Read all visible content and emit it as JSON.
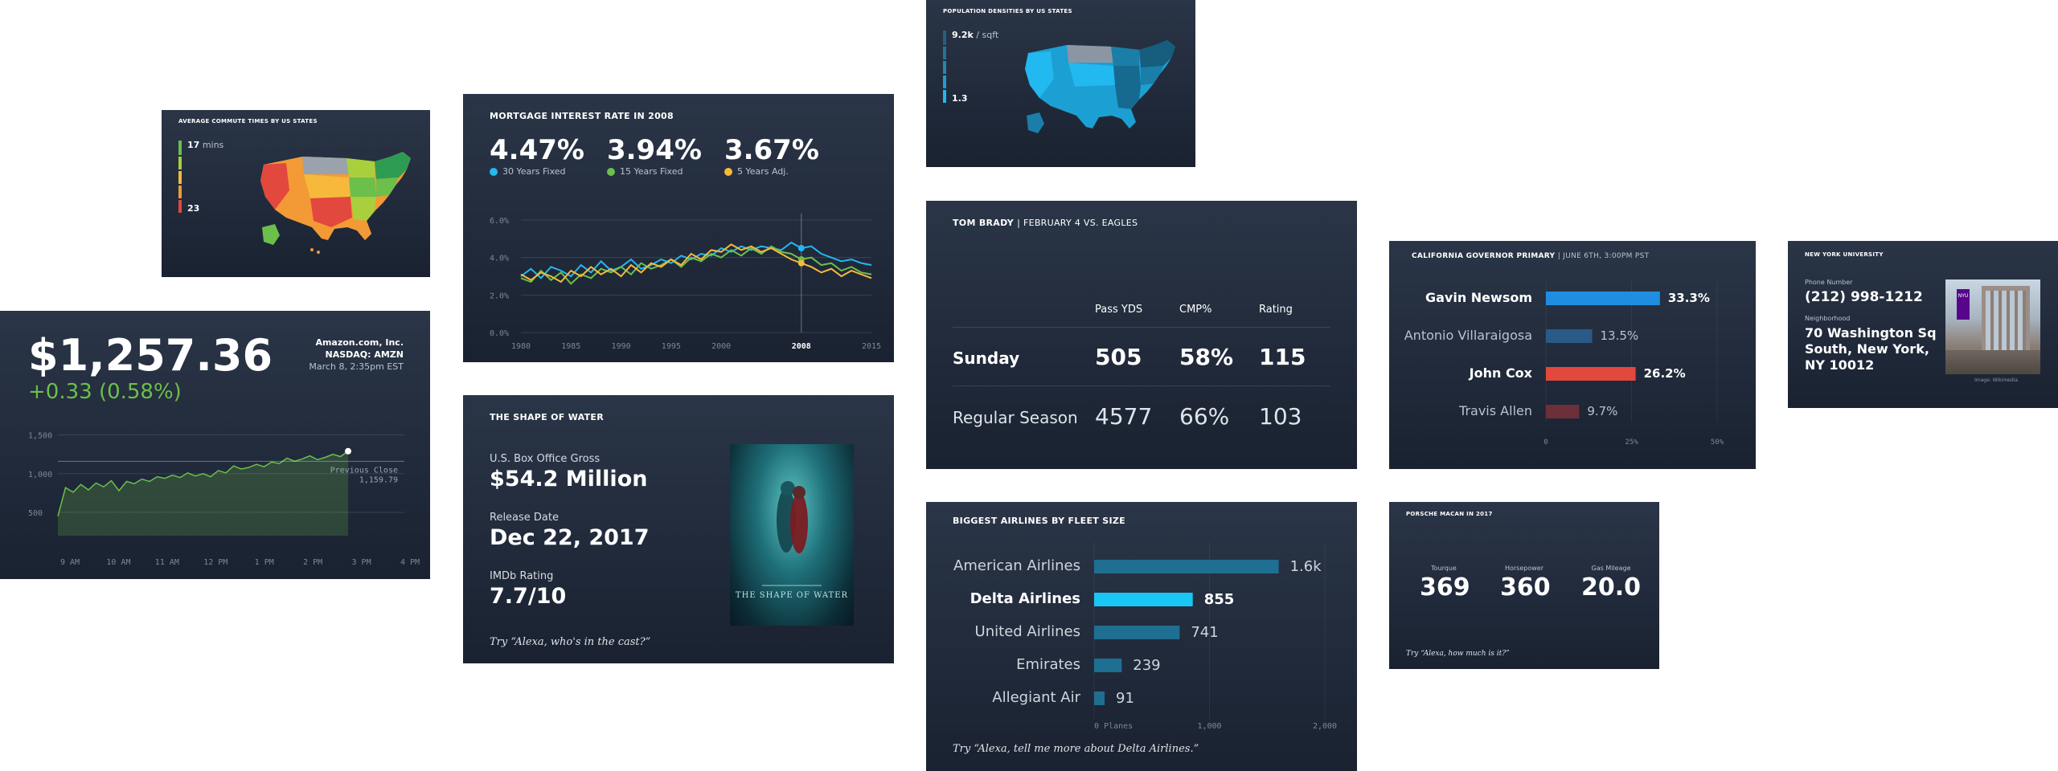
{
  "colors": {
    "blue": "#22b8f0",
    "green": "#6cbf4b",
    "yellow": "#f6b93b",
    "red": "#e2483d",
    "bar_blue": "#1f8de0",
    "bar_dark_blue": "#2a5a86",
    "bar_teal": "#1e6f91",
    "bar_cyan": "#19c6f4",
    "bar_dark_red": "#6d2f3a"
  },
  "commute": {
    "title": "AVERAGE COMMUTE TIMES BY US STATES",
    "max_value": "17",
    "max_unit": "mins",
    "min_value": "23",
    "legend_colors": [
      "#6cbf4b",
      "#a9cf3d",
      "#f6b93b",
      "#f39a36",
      "#e2483d"
    ],
    "map_icon": "us-map-icon"
  },
  "mortgage": {
    "title": "MORTGAGE INTEREST RATE IN 2008",
    "rates": [
      {
        "value": "4.47%",
        "label": "30 Years Fixed",
        "color": "#22b8f0"
      },
      {
        "value": "3.94%",
        "label": "15 Years Fixed",
        "color": "#6cbf4b"
      },
      {
        "value": "3.67%",
        "label": "5 Years Adj.",
        "color": "#f6b93b"
      }
    ],
    "y_ticks": [
      "6.0%",
      "4.0%",
      "2.0%",
      "0.0%"
    ],
    "x_ticks": [
      "1980",
      "1985",
      "1990",
      "1995",
      "2000",
      "2008",
      "2015"
    ]
  },
  "mortgage_chart": {
    "type": "line",
    "x": [
      1980,
      1981,
      1982,
      1983,
      1984,
      1985,
      1986,
      1987,
      1988,
      1989,
      1990,
      1991,
      1992,
      1993,
      1994,
      1995,
      1996,
      1997,
      1998,
      1999,
      2000,
      2001,
      2002,
      2003,
      2004,
      2005,
      2006,
      2007,
      2008,
      2009,
      2010,
      2011,
      2012,
      2013,
      2014,
      2015
    ],
    "series": [
      {
        "name": "30 Years Fixed",
        "color": "#22b8f0",
        "values": [
          3.0,
          3.4,
          2.9,
          3.5,
          3.3,
          3.0,
          3.6,
          3.2,
          3.8,
          3.3,
          3.5,
          3.9,
          3.4,
          3.6,
          3.9,
          3.7,
          4.1,
          3.9,
          4.2,
          4.1,
          4.5,
          4.3,
          4.6,
          4.4,
          4.6,
          4.5,
          4.4,
          4.8,
          4.5,
          4.6,
          4.2,
          4.0,
          3.8,
          3.9,
          3.7,
          3.6
        ]
      },
      {
        "name": "15 Years Fixed",
        "color": "#6cbf4b",
        "values": [
          2.9,
          2.7,
          3.3,
          2.8,
          3.2,
          2.6,
          3.1,
          2.9,
          3.4,
          3.2,
          3.5,
          3.1,
          3.7,
          3.4,
          3.6,
          3.9,
          3.5,
          4.0,
          3.8,
          4.2,
          4.0,
          4.4,
          4.1,
          4.5,
          4.2,
          4.6,
          4.3,
          4.2,
          3.9,
          4.0,
          3.6,
          3.7,
          3.3,
          3.5,
          3.2,
          3.1
        ]
      },
      {
        "name": "5 Years Adj.",
        "color": "#f6b93b",
        "values": [
          3.1,
          2.8,
          3.2,
          3.0,
          2.7,
          3.3,
          3.0,
          3.5,
          3.1,
          3.4,
          3.0,
          3.6,
          3.2,
          3.7,
          3.5,
          3.9,
          3.6,
          4.2,
          3.9,
          4.4,
          4.3,
          4.7,
          4.4,
          4.6,
          4.3,
          4.5,
          4.2,
          3.9,
          3.7,
          3.5,
          3.2,
          3.4,
          3.0,
          3.3,
          3.1,
          2.9
        ]
      }
    ],
    "ylim": [
      0,
      6
    ],
    "highlight_x": 2008
  },
  "population": {
    "title": "POPULATION DENSITIES BY US STATES",
    "max_value": "9.2k",
    "max_unit": "/ sqft",
    "min_value": "1.3",
    "map_icon": "us-map-icon"
  },
  "stock": {
    "price": "$1,257.36",
    "change": "+0.33 (0.58%)",
    "company": "Amazon.com, Inc.",
    "ticker": "NASDAQ: AMZN",
    "date": "March 8, 2:35pm EST",
    "y_ticks": [
      "1,500",
      "1,000",
      "500"
    ],
    "x_ticks": [
      "9 AM",
      "10 AM",
      "11 AM",
      "12 PM",
      "1 PM",
      "2 PM",
      "3 PM",
      "4 PM"
    ],
    "prev_close_label": "Previous Close",
    "prev_close_value": "1,159.79"
  },
  "stock_chart": {
    "type": "area",
    "values": [
      450,
      820,
      760,
      860,
      790,
      880,
      830,
      910,
      780,
      900,
      870,
      930,
      900,
      960,
      940,
      980,
      950,
      1010,
      970,
      1000,
      960,
      1040,
      1010,
      1100,
      1060,
      1080,
      1120,
      1090,
      1150,
      1130,
      1200,
      1160,
      1190,
      1230,
      1180,
      1210,
      1250,
      1220,
      1290
    ],
    "ylim": [
      200,
      1650
    ],
    "prev_close": 1159.79,
    "color": "#6cbf4b"
  },
  "movie": {
    "title": "THE SHAPE OF WATER",
    "items": [
      {
        "label": "U.S. Box Office Gross",
        "value": "$54.2 Million"
      },
      {
        "label": "Release Date",
        "value": "Dec 22, 2017"
      },
      {
        "label": "IMDb Rating",
        "value": "7.7/10"
      }
    ],
    "hint": "Try “Alexa, who's in the cast?”",
    "poster_title": "THE SHAPE OF WATER"
  },
  "brady": {
    "title_bold": "TOM BRADY",
    "title_rest": "| FEBRUARY 4 VS. EAGLES",
    "headers": [
      "Pass YDS",
      "CMP%",
      "Rating"
    ],
    "rows": [
      {
        "label": "Sunday",
        "values": [
          "505",
          "58%",
          "115"
        ]
      },
      {
        "label": "Regular Season",
        "values": [
          "4577",
          "66%",
          "103"
        ]
      }
    ]
  },
  "airlines": {
    "title": "BIGGEST AIRLINES BY FLEET SIZE",
    "bars": [
      {
        "name": "American Airlines",
        "label": "1.6k",
        "value": 1600,
        "highlight": false
      },
      {
        "name": "Delta Airlines",
        "label": "855",
        "value": 855,
        "highlight": true
      },
      {
        "name": "United Airlines",
        "label": "741",
        "value": 741,
        "highlight": false
      },
      {
        "name": "Emirates",
        "label": "239",
        "value": 239,
        "highlight": false
      },
      {
        "name": "Allegiant Air",
        "label": "91",
        "value": 91,
        "highlight": false
      }
    ],
    "x_ticks": [
      "0 Planes",
      "1,000",
      "2,000"
    ],
    "xmax": 2000,
    "hint": "Try “Alexa, tell me more about Delta Airlines.”"
  },
  "governor": {
    "title_bold": "CALIFORNIA GOVERNOR PRIMARY",
    "title_rest": "| JUNE 6TH, 3:00PM PST",
    "bars": [
      {
        "name": "Gavin Newsom",
        "label": "33.3%",
        "value": 33.3,
        "bold": true,
        "color": "#1f8de0"
      },
      {
        "name": "Antonio Villaraigosa",
        "label": "13.5%",
        "value": 13.5,
        "bold": false,
        "color": "#2a5a86"
      },
      {
        "name": "John Cox",
        "label": "26.2%",
        "value": 26.2,
        "bold": true,
        "color": "#e2483d"
      },
      {
        "name": "Travis Allen",
        "label": "9.7%",
        "value": 9.7,
        "bold": false,
        "color": "#6d2f3a"
      }
    ],
    "x_ticks": [
      "0",
      "25%",
      "50%"
    ],
    "xmax": 50
  },
  "porsche": {
    "title": "PORSCHE MACAN IN 2017",
    "stats": [
      {
        "label": "Tourque",
        "value": "369"
      },
      {
        "label": "Horsepower",
        "value": "360"
      },
      {
        "label": "Gas Mileage",
        "value": "20.0"
      }
    ],
    "hint": "Try “Alexa, how much is it?”"
  },
  "nyu": {
    "title": "NEW YORK UNIVERSITY",
    "phone_label": "Phone Number",
    "phone": "(212) 998-1212",
    "neighborhood_label": "Neighborhood",
    "address_lines": [
      "70 Washington Sq",
      "South, New York,",
      "NY 10012"
    ],
    "image_credit": "Image: Wikimedia",
    "flag_text": "NYU"
  }
}
